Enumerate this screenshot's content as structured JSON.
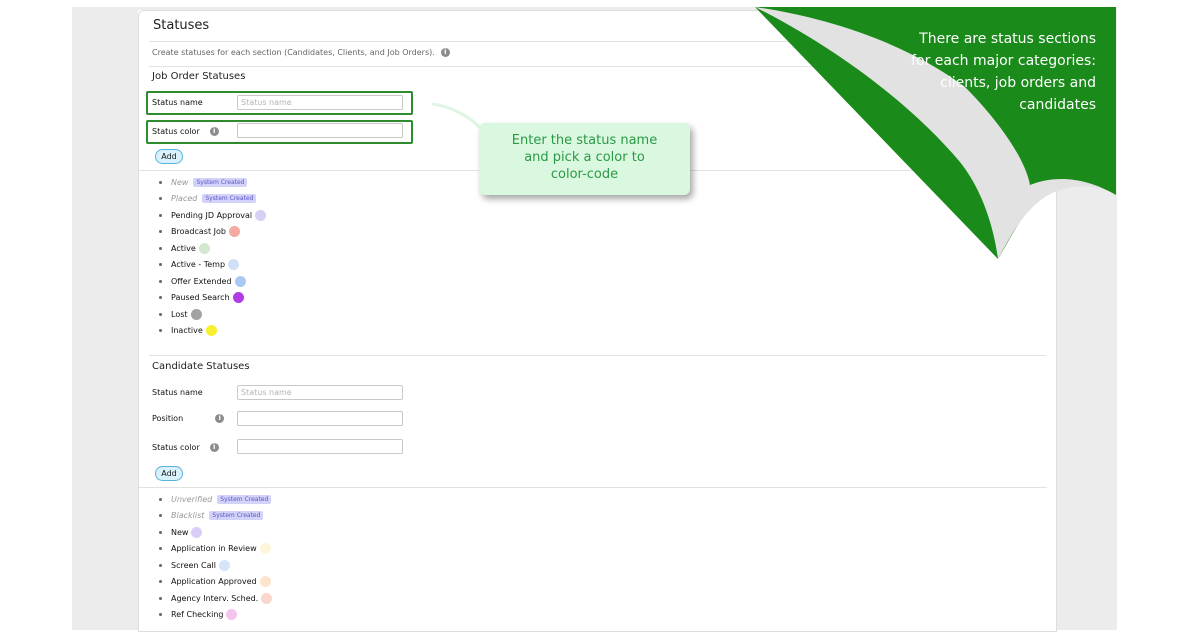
{
  "page": {
    "title": "Statuses",
    "description": "Create statuses for each section (Candidates, Clients, and Job Orders)."
  },
  "job_order": {
    "section_title": "Job Order Statuses",
    "status_name_label": "Status name",
    "status_name_placeholder": "Status name",
    "status_color_label": "Status color",
    "add_label": "Add",
    "statuses": [
      {
        "label": "New",
        "system": true,
        "badge": "System Created"
      },
      {
        "label": "Placed",
        "system": true,
        "badge": "System Created"
      },
      {
        "label": "Pending JD Approval",
        "color": "#d7d0f5"
      },
      {
        "label": "Broadcast Job",
        "color": "#f4aaa3"
      },
      {
        "label": "Active",
        "color": "#d3e8cd"
      },
      {
        "label": "Active - Temp",
        "color": "#cfe0f7"
      },
      {
        "label": "Offer Extended",
        "color": "#a9c8f2"
      },
      {
        "label": "Paused Search",
        "color": "#b13be6"
      },
      {
        "label": "Lost",
        "color": "#a3a3a3"
      },
      {
        "label": "Inactive",
        "color": "#f6f02e"
      }
    ]
  },
  "candidate": {
    "section_title": "Candidate Statuses",
    "status_name_label": "Status name",
    "status_name_placeholder": "Status name",
    "position_label": "Position",
    "status_color_label": "Status color",
    "add_label": "Add",
    "statuses": [
      {
        "label": "Unverified",
        "system": true,
        "badge": "System Created"
      },
      {
        "label": "Blacklist",
        "system": true,
        "badge": "System Created"
      },
      {
        "label": "New",
        "color": "#d8cdf7"
      },
      {
        "label": "Application in Review",
        "color": "#fdf6d9"
      },
      {
        "label": "Screen Call",
        "color": "#d6e4fa"
      },
      {
        "label": "Application Approved",
        "color": "#fde5cc"
      },
      {
        "label": "Agency Interv. Sched.",
        "color": "#fbd6cc"
      },
      {
        "label": "Ref Checking",
        "color": "#f3c4f0"
      }
    ]
  },
  "callout": {
    "lines": [
      "Enter the status name",
      "and pick a color to",
      "color-code"
    ]
  },
  "corner": {
    "lines": [
      "There are status sections",
      "for each major categories:",
      "clients, job orders and",
      "candidates"
    ],
    "color": "#1a8a1a"
  },
  "icons": {
    "info": "info-icon"
  }
}
